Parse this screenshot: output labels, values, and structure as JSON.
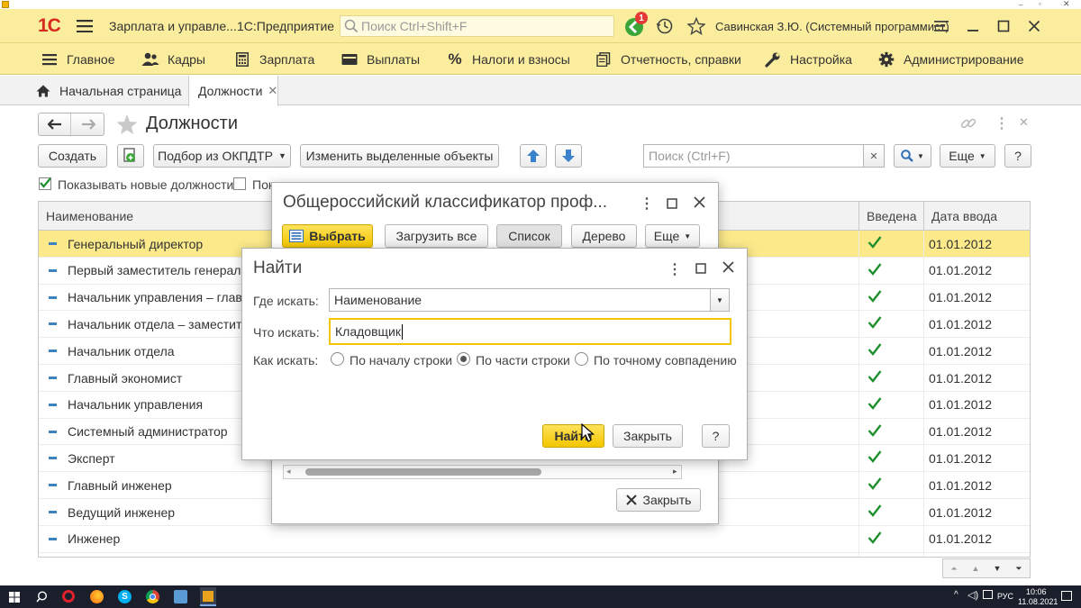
{
  "window": {
    "title": "Зарплата и управле...",
    "platform": "1С:Предприятие",
    "search_placeholder": "Поиск Ctrl+Shift+F",
    "notification_count": "1",
    "user": "Савинская З.Ю. (Системный программист)"
  },
  "menu": {
    "items": [
      "Главное",
      "Кадры",
      "Зарплата",
      "Выплаты",
      "Налоги и взносы",
      "Отчетность, справки",
      "Настройка",
      "Администрирование"
    ]
  },
  "tabs": {
    "home": "Начальная страница",
    "active": "Должности"
  },
  "form": {
    "title": "Должности",
    "toolbar": {
      "create": "Создать",
      "pick": "Подбор из ОКПДТР",
      "edit_selected": "Изменить выделенные объекты",
      "search_placeholder": "Поиск (Ctrl+F)",
      "more": "Еще",
      "help": "?"
    },
    "show_new_label": "Показывать новые должности",
    "second_checkbox_label": "Пок",
    "columns": [
      "Наименование",
      "Введена",
      "Дата ввода"
    ],
    "rows": [
      {
        "name": "Генеральный директор",
        "date": "01.01.2012"
      },
      {
        "name": "Первый заместитель генеральн",
        "date": "01.01.2012"
      },
      {
        "name": "Начальник управления – главн",
        "date": "01.01.2012"
      },
      {
        "name": "Начальник отдела – заместител",
        "date": "01.01.2012"
      },
      {
        "name": "Начальник отдела",
        "date": "01.01.2012"
      },
      {
        "name": "Главный экономист",
        "date": "01.01.2012"
      },
      {
        "name": "Начальник управления",
        "date": "01.01.2012"
      },
      {
        "name": "Системный администратор",
        "date": "01.01.2012"
      },
      {
        "name": "Эксперт",
        "date": "01.01.2012"
      },
      {
        "name": "Главный инженер",
        "date": "01.01.2012"
      },
      {
        "name": "Ведущий инженер",
        "date": "01.01.2012"
      },
      {
        "name": "Инженер",
        "date": "01.01.2012"
      }
    ]
  },
  "classifier_dialog": {
    "title": "Общероссийский классификатор проф...",
    "select": "Выбрать",
    "load_all": "Загрузить все",
    "list": "Список",
    "tree": "Дерево",
    "more": "Еще",
    "close": "Закрыть"
  },
  "find_dialog": {
    "title": "Найти",
    "where_label": "Где искать:",
    "where_value": "Наименование",
    "what_label": "Что искать:",
    "what_value": "Кладовщик",
    "how_label": "Как искать:",
    "options": [
      "По началу строки",
      "По части строки",
      "По точному совпадению"
    ],
    "selected_option": 1,
    "find_button": "Найти",
    "close_button": "Закрыть",
    "help_button": "?"
  },
  "taskbar": {
    "lang": "РУС",
    "time": "10:06",
    "date": "11.08.2021"
  }
}
